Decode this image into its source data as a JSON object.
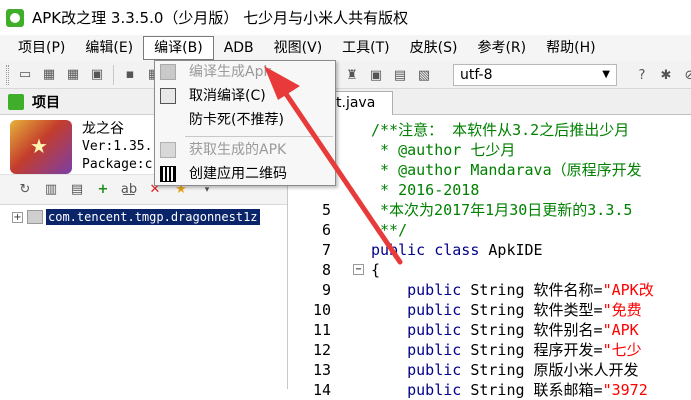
{
  "window": {
    "title": "APK改之理 3.3.5.0（少月版） 七少月与小米人共有版权"
  },
  "menu": [
    {
      "label": "项目(P)"
    },
    {
      "label": "编辑(E)"
    },
    {
      "label": "编译(B)",
      "active": true
    },
    {
      "label": "ADB"
    },
    {
      "label": "视图(V)"
    },
    {
      "label": "工具(T)"
    },
    {
      "label": "皮肤(S)"
    },
    {
      "label": "参考(R)"
    },
    {
      "label": "帮助(H)"
    }
  ],
  "toolbar": {
    "encoding": "utf-8"
  },
  "build_menu": {
    "items": [
      {
        "label": "编译生成Apk",
        "enabled": false,
        "icon": "build-icon"
      },
      {
        "label": "取消编译(C)",
        "enabled": true,
        "icon": "cancel-build-icon"
      },
      {
        "label": "防卡死(不推荐)",
        "enabled": true,
        "icon": ""
      },
      {
        "label": "获取生成的APK",
        "enabled": false,
        "icon": "get-apk-icon"
      },
      {
        "label": "创建应用二维码",
        "enabled": true,
        "icon": "qr-code-icon"
      }
    ]
  },
  "project_panel": {
    "title": "项目",
    "app_name": "龙之谷",
    "version": "Ver:1.35.",
    "package": "Package:c",
    "tree_node": "com.tencent.tmgp.dragonnest1z"
  },
  "editor": {
    "tab_label": "t.java",
    "lines": [
      {
        "num": "",
        "parts": [
          {
            "t": "/**注意： 本软件从3.2之后推出少月",
            "c": "comment"
          }
        ]
      },
      {
        "num": "",
        "parts": [
          {
            "t": " * @author 七少月",
            "c": "comment"
          }
        ]
      },
      {
        "num": "",
        "parts": [
          {
            "t": " * @author Mandarava（原程序开发",
            "c": "comment"
          }
        ]
      },
      {
        "num": "",
        "parts": [
          {
            "t": " * 2016-2018",
            "c": "comment"
          }
        ]
      },
      {
        "num": "5",
        "parts": [
          {
            "t": " *本次为2017年1月30日更新的3.3.5",
            "c": "comment"
          }
        ]
      },
      {
        "num": "6",
        "parts": [
          {
            "t": " **/",
            "c": "comment"
          }
        ]
      },
      {
        "num": "7",
        "parts": [
          {
            "t": "public class ",
            "c": "kw"
          },
          {
            "t": "ApkIDE",
            "c": "plain"
          }
        ]
      },
      {
        "num": "8",
        "fold": true,
        "parts": [
          {
            "t": "{",
            "c": "plain"
          }
        ]
      },
      {
        "num": "9",
        "parts": [
          {
            "t": "    public ",
            "c": "kw"
          },
          {
            "t": "String 软件名称=",
            "c": "plain"
          },
          {
            "t": "\"APK改",
            "c": "str"
          }
        ]
      },
      {
        "num": "10",
        "parts": [
          {
            "t": "    public ",
            "c": "kw"
          },
          {
            "t": "String 软件类型=",
            "c": "plain"
          },
          {
            "t": "\"免费",
            "c": "str"
          }
        ]
      },
      {
        "num": "11",
        "parts": [
          {
            "t": "    public ",
            "c": "kw"
          },
          {
            "t": "String 软件别名=",
            "c": "plain"
          },
          {
            "t": "\"APK ",
            "c": "str"
          }
        ]
      },
      {
        "num": "12",
        "parts": [
          {
            "t": "    public ",
            "c": "kw"
          },
          {
            "t": "String 程序开发=",
            "c": "plain"
          },
          {
            "t": "\"七少",
            "c": "str"
          }
        ]
      },
      {
        "num": "13",
        "parts": [
          {
            "t": "    public ",
            "c": "kw"
          },
          {
            "t": "String 原版小米人开发",
            "c": "plain"
          }
        ]
      },
      {
        "num": "14",
        "parts": [
          {
            "t": "    public ",
            "c": "kw"
          },
          {
            "t": "String 联系邮箱=",
            "c": "plain"
          },
          {
            "t": "\"3972",
            "c": "str"
          }
        ]
      }
    ]
  },
  "colors": {
    "accent": "#3fae2a",
    "annotation_arrow": "#e83a3a",
    "selection": "#0a246a",
    "comment": "#008000",
    "keyword": "#00008b",
    "string": "#ff0000"
  }
}
